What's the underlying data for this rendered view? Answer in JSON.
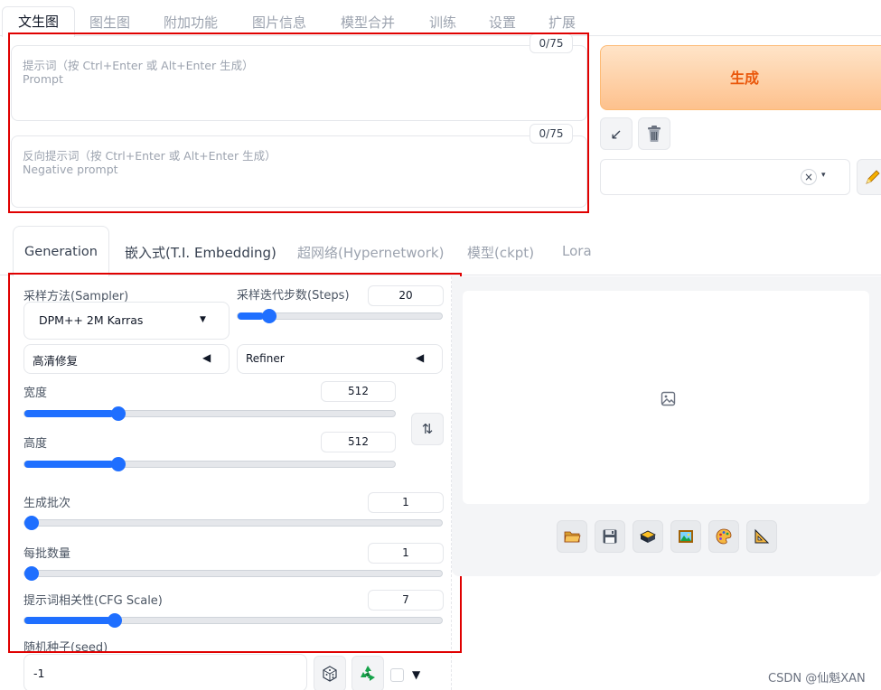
{
  "top_tabs": {
    "txt2img": "文生图",
    "img2img": "图生图",
    "extras": "附加功能",
    "png_info": "图片信息",
    "merge": "模型合并",
    "train": "训练",
    "settings": "设置",
    "extensions": "扩展"
  },
  "prompt": {
    "counter": "0/75",
    "placeholder_line1": "提示词（按 Ctrl+Enter 或 Alt+Enter 生成）",
    "placeholder_line2": "Prompt"
  },
  "negative_prompt": {
    "counter": "0/75",
    "placeholder_line1": "反向提示词（按 Ctrl+Enter 或 Alt+Enter 生成）",
    "placeholder_line2": "Negative prompt"
  },
  "actions": {
    "generate": "生成",
    "read_params_icon": "↙",
    "trash_icon": "trash-icon",
    "style_clear": "×",
    "style_caret": "▾"
  },
  "sub_tabs": {
    "generation": "Generation",
    "embedding": "嵌入式(T.I. Embedding)",
    "hypernetwork": "超网络(Hypernetwork)",
    "checkpoint": "模型(ckpt)",
    "lora": "Lora"
  },
  "params": {
    "sampler_label": "采样方法(Sampler)",
    "sampler_value": "DPM++ 2M Karras",
    "steps_label": "采样迭代步数(Steps)",
    "steps_value": "20",
    "steps_fraction": 0.1266,
    "hires_label": "高清修复",
    "refiner_label": "Refiner",
    "width_label": "宽度",
    "width_value": "512",
    "width_fraction": 0.2424,
    "height_label": "高度",
    "height_value": "512",
    "height_fraction": 0.2424,
    "swap_icon": "⇅",
    "batch_count_label": "生成批次",
    "batch_count_value": "1",
    "batch_count_fraction": 0.0,
    "batch_size_label": "每批数量",
    "batch_size_value": "1",
    "batch_size_fraction": 0.0,
    "cfg_label": "提示词相关性(CFG Scale)",
    "cfg_value": "7",
    "cfg_fraction": 0.2069,
    "seed_label": "随机种子(seed)",
    "seed_value": "-1"
  },
  "watermark": "CSDN @仙魁XAN"
}
